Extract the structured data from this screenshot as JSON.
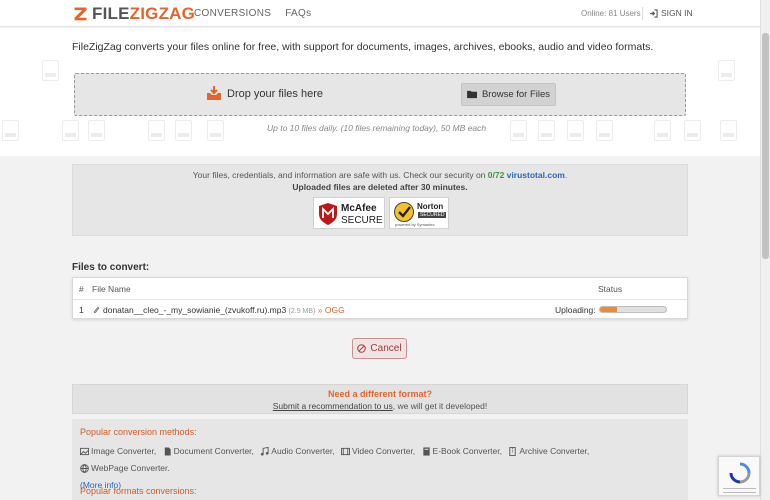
{
  "header": {
    "logo_prefix": "FILE",
    "logo_suffix": "ZIGZAG",
    "nav": [
      "CONVERSIONS",
      "FAQs"
    ],
    "online": "Online: 81 Users",
    "signin": "SIGN IN"
  },
  "hero": {
    "intro": "FileZigZag converts your files online for free, with support for documents, images, archives, ebooks, audio and video formats.",
    "drop_label": "Drop your files here",
    "browse_label": "Browse for Files",
    "limits": "Up to 10 files daily. (10 files remaining today), 50 MB each"
  },
  "security": {
    "line1_prefix": "Your files, credentials, and information are safe with us. Check our security on",
    "ratio": "0/72",
    "site": "virustotal.com",
    "line1_suffix": ".",
    "line2": "Uploaded files are deleted after 30 minutes.",
    "mcafee": [
      "McAfee",
      "SECURE"
    ],
    "norton": [
      "Norton",
      "SECURED",
      "powered by Symantec"
    ]
  },
  "files": {
    "title": "Files to convert:",
    "headers": {
      "num": "#",
      "name": "File Name",
      "status": "Status"
    },
    "rows": [
      {
        "num": "1",
        "name": "donatan__cleo_-_my_sowianie_(zvukoff.ru).mp3",
        "size": "(2.9 MB)",
        "arrow": "»",
        "target": "OGG",
        "status": "Uploading:",
        "progress": 0.25
      }
    ],
    "cancel": "Cancel"
  },
  "need": {
    "title": "Need a different format?",
    "link": "Submit a recommendation to us",
    "rest": ", we will get it developed!"
  },
  "popular": {
    "title": "Popular conversion methods:",
    "items": [
      "Image Converter,",
      "Document Converter,",
      "Audio Converter,",
      "Video Converter,",
      "E-Book Converter,",
      "Archive Converter,",
      "WebPage Converter."
    ],
    "more": "(More info)",
    "title2": "Popular formats conversions:"
  },
  "colors": {
    "accent": "#e8632b",
    "link": "#2a66b8",
    "safe": "#3a9a3a",
    "progress": "#ef8a2e"
  }
}
